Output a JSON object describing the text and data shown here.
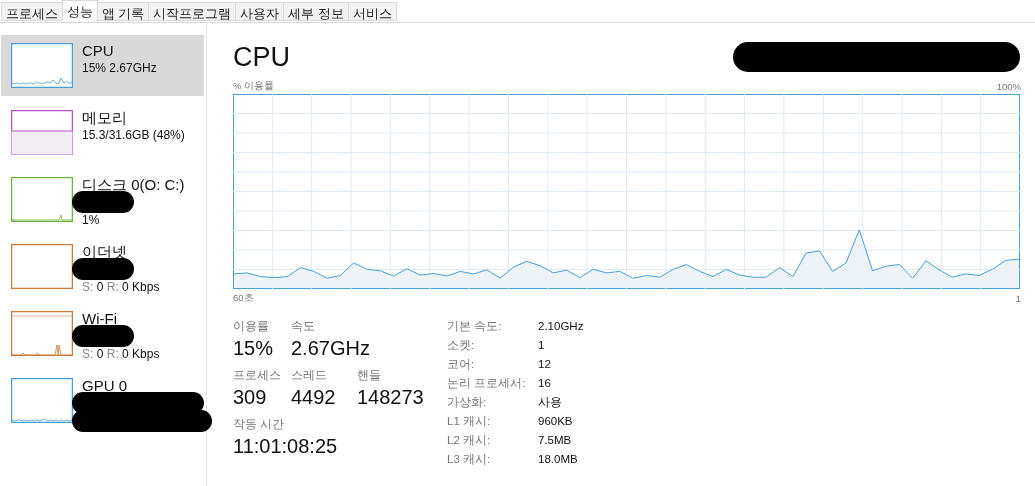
{
  "tabs": [
    {
      "label": "프로세스",
      "selected": false
    },
    {
      "label": "성능",
      "selected": true
    },
    {
      "label": "앱 기록",
      "selected": false
    },
    {
      "label": "시작프로그램",
      "selected": false
    },
    {
      "label": "사용자",
      "selected": false
    },
    {
      "label": "세부 정보",
      "selected": false
    },
    {
      "label": "서비스",
      "selected": false
    }
  ],
  "sidebar": {
    "items": [
      {
        "kind": "cpu",
        "name": "CPU",
        "detail": "15% 2.67GHz",
        "color": "#4a9fd8",
        "selected": true,
        "redacted": false
      },
      {
        "kind": "memory",
        "name": "메모리",
        "detail": "15.3/31.6GB (48%)",
        "color": "#b552c9",
        "selected": false,
        "redacted": false
      },
      {
        "kind": "disk",
        "name": "디스크 0(O: C:)",
        "detail": "1%",
        "color": "#6bb33a",
        "selected": false,
        "redacted": true
      },
      {
        "kind": "network",
        "name": "이더넷",
        "speed": {
          "send_label": "S:",
          "send": "0",
          "recv_label": "R:",
          "recv": "0 Kbps"
        },
        "color": "#c77c3a",
        "selected": false,
        "redacted": true
      },
      {
        "kind": "wifi",
        "name": "Wi-Fi",
        "speed": {
          "send_label": "S:",
          "send": "0",
          "recv_label": "R:",
          "recv": "0 Kbps"
        },
        "color": "#c77c3a",
        "selected": false,
        "redacted": true
      },
      {
        "kind": "gpu",
        "name": "GPU 0",
        "color": "#4a9fd8",
        "selected": false,
        "redacted": true
      }
    ]
  },
  "header": {
    "title": "CPU",
    "redacted": true
  },
  "graph": {
    "ylabel": "% 이용률",
    "max_label": "100%",
    "start_label": "60초",
    "end_label": "1"
  },
  "stats": {
    "big": [
      {
        "label": "이용률",
        "value": "15%"
      },
      {
        "label": "속도",
        "value": "2.67GHz"
      }
    ],
    "counts": [
      {
        "label": "프로세스",
        "value": "309"
      },
      {
        "label": "스레드",
        "value": "4492"
      },
      {
        "label": "핸들",
        "value": "148273"
      }
    ],
    "uptime": {
      "label": "작동 시간",
      "value": "11:01:08:25"
    },
    "specs": [
      {
        "label": "기본 속도:",
        "value": "2.10GHz"
      },
      {
        "label": "소켓:",
        "value": "1"
      },
      {
        "label": "코어:",
        "value": "12"
      },
      {
        "label": "논리 프로세서:",
        "value": "16"
      },
      {
        "label": "가상화:",
        "value": "사용"
      },
      {
        "label": "L1 캐시:",
        "value": "960KB"
      },
      {
        "label": "L2 캐시:",
        "value": "7.5MB"
      },
      {
        "label": "L3 캐시:",
        "value": "18.0MB"
      }
    ]
  }
}
